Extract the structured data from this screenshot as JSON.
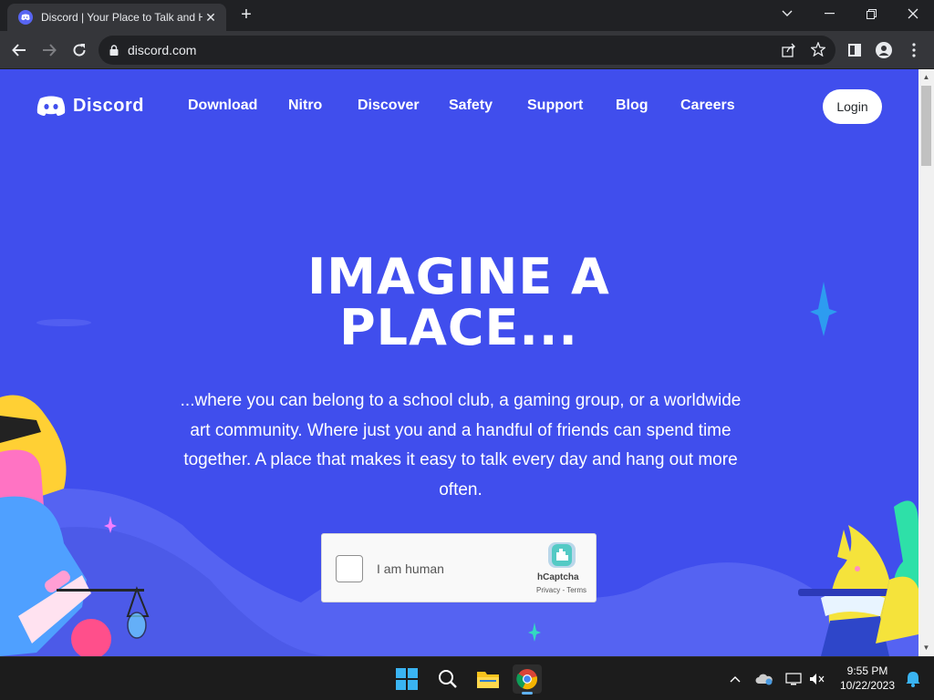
{
  "browser": {
    "tab_title": "Discord | Your Place to Talk and Hang Out",
    "url": "discord.com"
  },
  "header": {
    "logo_text": "Discord",
    "nav": [
      "Download",
      "Nitro",
      "Discover",
      "Safety",
      "Support",
      "Blog",
      "Careers"
    ],
    "login_label": "Login"
  },
  "hero": {
    "title_line1": "IMAGINE A",
    "title_line2": "PLACE...",
    "description": "...where you can belong to a school club, a gaming group, or a worldwide art community. Where just you and a handful of friends can spend time together. A place that makes it easy to talk every day and hang out more often."
  },
  "captcha": {
    "label": "I am human",
    "brand": "hCaptcha",
    "privacy": "Privacy",
    "separator": " - ",
    "terms": "Terms"
  },
  "taskbar": {
    "time": "9:55 PM",
    "date": "10/22/2023"
  },
  "colors": {
    "blurple": "#404eed",
    "discord_brand": "#5865f2",
    "chrome_dark": "#202124",
    "chrome_toolbar": "#35363a"
  },
  "icons": {
    "tab_favicon": "discord-icon",
    "back": "back-arrow-icon",
    "forward": "forward-arrow-icon",
    "reload": "reload-icon",
    "lock": "lock-icon",
    "share": "share-icon",
    "bookmark": "star-icon",
    "sidepanel": "side-panel-icon",
    "profile": "profile-icon",
    "menu": "kebab-menu-icon"
  }
}
